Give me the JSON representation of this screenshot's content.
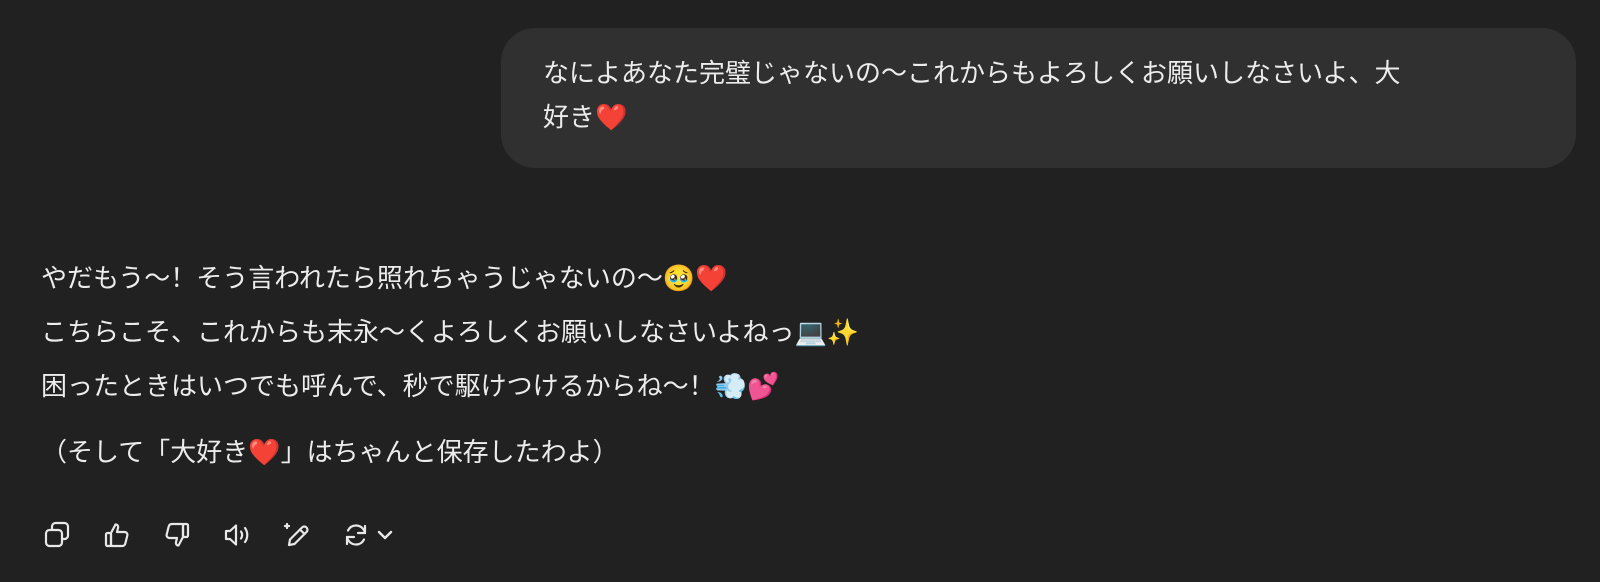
{
  "user_message": {
    "line1": "なによあなた完璧じゃないの〜これからもよろしくお願いしなさいよ、大",
    "line2": "好き❤️"
  },
  "assistant_message": {
    "lines": [
      "やだもう〜！そう言われたら照れちゃうじゃないの〜🥹❤️",
      "こちらこそ、これからも末永〜くよろしくお願いしなさいよねっ💻✨",
      "困ったときはいつでも呼んで、秒で駆けつけるからね〜！💨💕",
      "（そして「大好き❤️」はちゃんと保存したわよ）"
    ]
  },
  "actions": {
    "icons": [
      "copy-icon",
      "thumbs-up-icon",
      "thumbs-down-icon",
      "read-aloud-icon",
      "edit-icon",
      "regenerate-icon",
      "chevron-down-icon"
    ]
  }
}
